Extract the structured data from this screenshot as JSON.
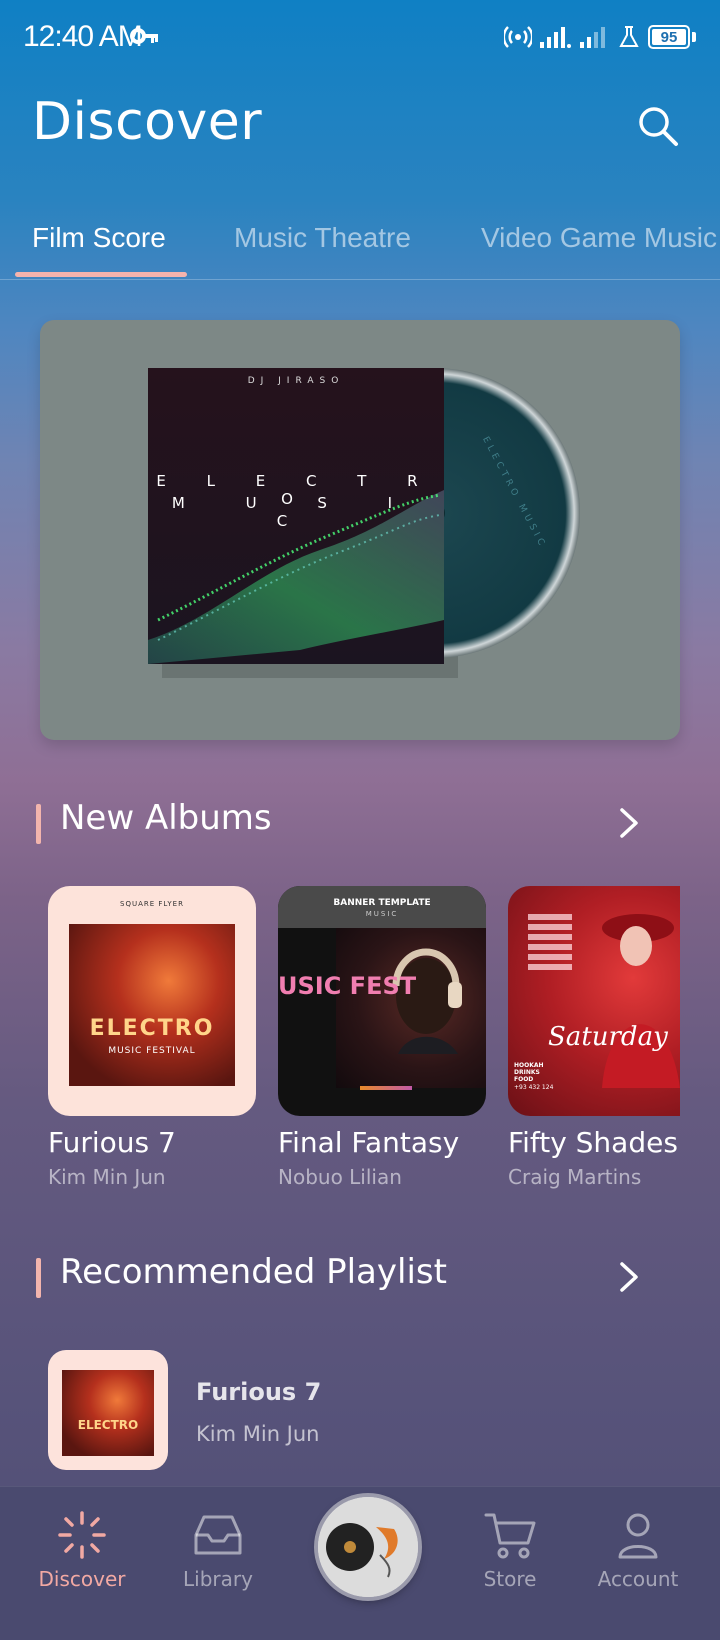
{
  "status_bar": {
    "time": "12:40 AM",
    "battery": "95",
    "battery_level": 0.95,
    "icons": [
      "key-icon",
      "hotspot-icon",
      "signal-icon",
      "signal-icon",
      "flask-icon",
      "battery-icon"
    ]
  },
  "header": {
    "title": "Discover",
    "search_icon": "search-icon"
  },
  "tabs": [
    {
      "label": "Film Score",
      "active": true
    },
    {
      "label": "Music Theatre",
      "active": false
    },
    {
      "label": "Video Game Music",
      "active": false
    }
  ],
  "banner": {
    "dj_text": "DJ JIRASO",
    "line1": "E L E C T R O",
    "line2": "M U S I C",
    "disc_text": "ELECTRO MUSIC"
  },
  "new_albums": {
    "title": "New Albums",
    "items": [
      {
        "title": "Furious 7",
        "artist": "Kim Min Jun",
        "cover_top": "SQUARE FLYER",
        "cover_word": "ELECTRO",
        "cover_sub": "MUSIC FESTIVAL"
      },
      {
        "title": "Final Fantasy",
        "artist": "Nobuo Lilian",
        "cover_top": "BANNER TEMPLATE",
        "cover_sub2": "MUSIC",
        "cover_word": "USIC FEST"
      },
      {
        "title": "Fifty Shades",
        "artist": "Craig Martins",
        "cover_word": "Saturday",
        "cover_small": "HOOKAH DRINKS FOOD",
        "cover_phone": "+93 432 124"
      }
    ]
  },
  "recommended": {
    "title": "Recommended Playlist",
    "items": [
      {
        "title": "Furious 7",
        "artist": "Kim Min Jun",
        "cover_word": "ELECTRO"
      }
    ]
  },
  "bottom_nav": {
    "items": [
      {
        "label": "Discover",
        "icon": "discover-icon",
        "active": true
      },
      {
        "label": "Library",
        "icon": "library-icon",
        "active": false
      },
      {
        "label": "Store",
        "icon": "cart-icon",
        "active": false
      },
      {
        "label": "Account",
        "icon": "account-icon",
        "active": false
      }
    ],
    "player_icon": "now-playing-disc"
  },
  "colors": {
    "accent": "#f2a9a3",
    "nav_bg": "#4a4a6f",
    "banner_bg": "#7d8886"
  }
}
